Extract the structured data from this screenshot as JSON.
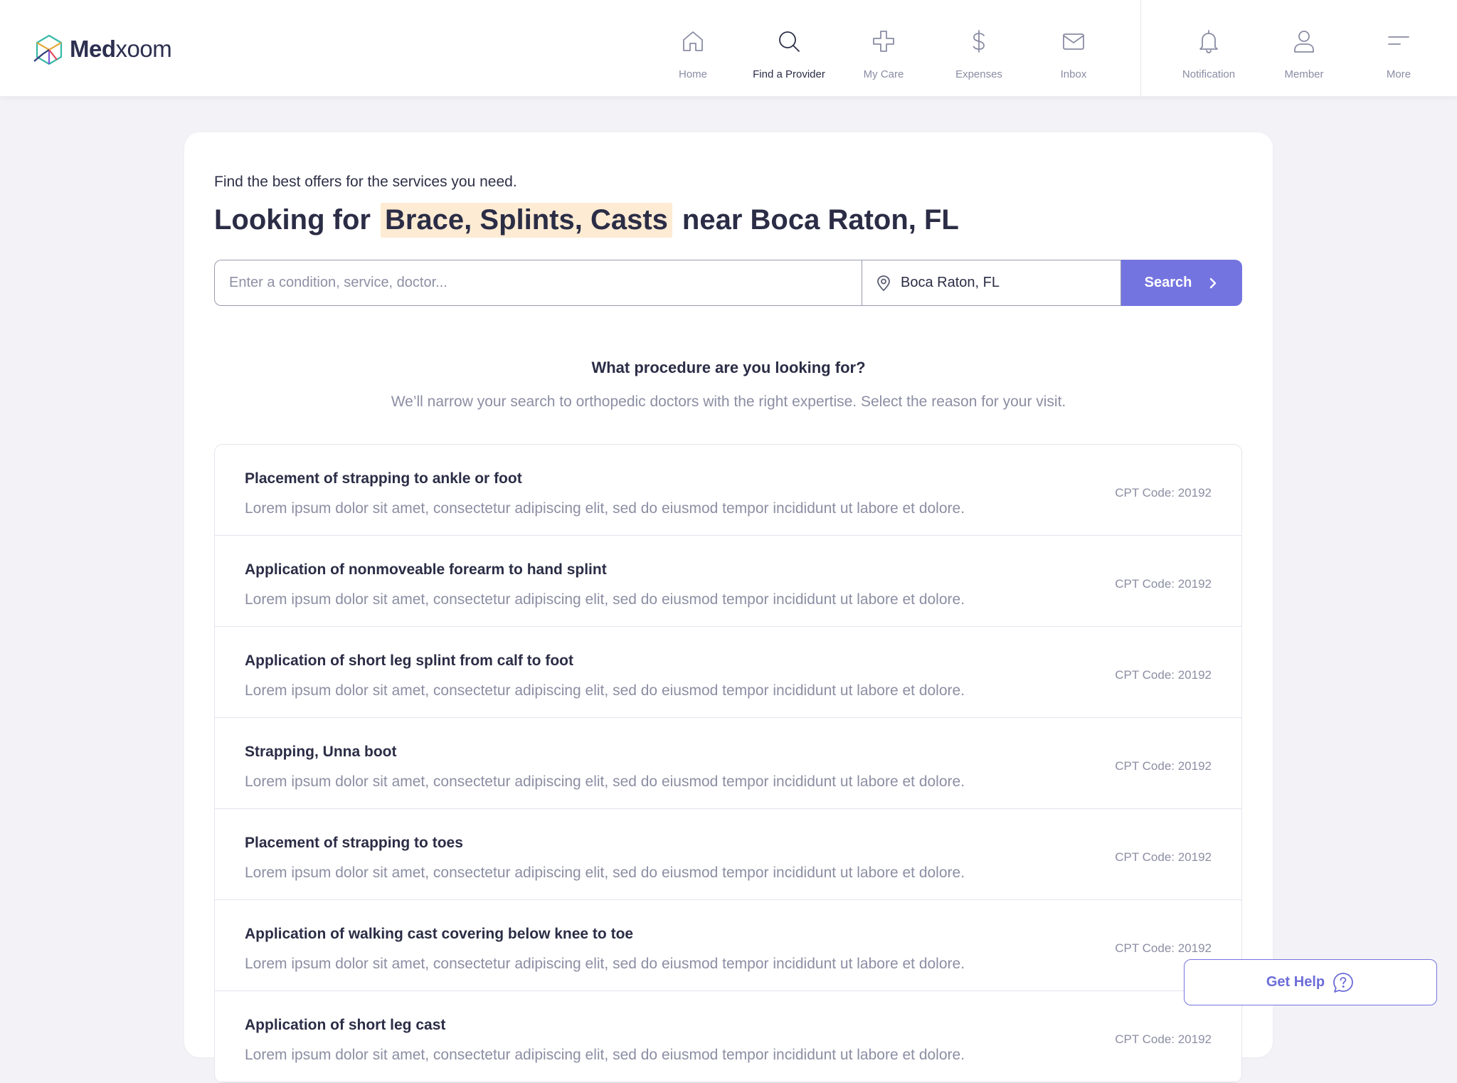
{
  "brand": {
    "name_bold": "Med",
    "name_light": "xoom"
  },
  "nav": {
    "items": [
      {
        "label": "Home",
        "icon": "home-icon",
        "active": false
      },
      {
        "label": "Find a Provider",
        "icon": "search-icon",
        "active": true
      },
      {
        "label": "My Care",
        "icon": "medical-cross-icon",
        "active": false
      },
      {
        "label": "Expenses",
        "icon": "dollar-icon",
        "active": false
      },
      {
        "label": "Inbox",
        "icon": "mail-icon",
        "active": false
      },
      {
        "label": "Notification",
        "icon": "bell-icon",
        "active": false
      },
      {
        "label": "Member",
        "icon": "user-icon",
        "active": false
      },
      {
        "label": "More",
        "icon": "menu-icon",
        "active": false
      }
    ]
  },
  "search": {
    "intro": "Find the best offers for the services you need.",
    "headline_prefix": "Looking for",
    "headline_highlight": "Brace, Splints, Casts",
    "headline_suffix": "near Boca Raton, FL",
    "query_placeholder": "Enter a condition, service, doctor...",
    "query_value": "",
    "location_value": "Boca Raton, FL",
    "button_label": "Search"
  },
  "procedures": {
    "title": "What procedure are you looking for?",
    "subtitle": "We’ll narrow your search to orthopedic doctors with the right expertise. Select the reason for your visit.",
    "items": [
      {
        "title": "Placement of strapping to ankle or foot",
        "description": "Lorem ipsum dolor sit amet, consectetur adipiscing elit, sed do eiusmod tempor incididunt ut labore et dolore.",
        "code": "CPT Code: 20192"
      },
      {
        "title": "Application of nonmoveable forearm to hand splint",
        "description": "Lorem ipsum dolor sit amet, consectetur adipiscing elit, sed do eiusmod tempor incididunt ut labore et dolore.",
        "code": "CPT Code: 20192"
      },
      {
        "title": "Application of short leg splint from calf to foot",
        "description": "Lorem ipsum dolor sit amet, consectetur adipiscing elit, sed do eiusmod tempor incididunt ut labore et dolore.",
        "code": "CPT Code: 20192"
      },
      {
        "title": "Strapping, Unna boot",
        "description": "Lorem ipsum dolor sit amet, consectetur adipiscing elit, sed do eiusmod tempor incididunt ut labore et dolore.",
        "code": "CPT Code: 20192"
      },
      {
        "title": "Placement of strapping to toes",
        "description": "Lorem ipsum dolor sit amet, consectetur adipiscing elit, sed do eiusmod tempor incididunt ut labore et dolore.",
        "code": "CPT Code: 20192"
      },
      {
        "title": "Application of walking cast covering below knee to toe",
        "description": "Lorem ipsum dolor sit amet, consectetur adipiscing elit, sed do eiusmod tempor incididunt ut labore et dolore.",
        "code": "CPT Code: 20192"
      },
      {
        "title": "Application of short leg cast",
        "description": "Lorem ipsum dolor sit amet, consectetur adipiscing elit, sed do eiusmod tempor incididunt ut labore et dolore.",
        "code": "CPT Code: 20192"
      }
    ]
  },
  "help": {
    "label": "Get Help",
    "icon": "help-chat-icon"
  },
  "colors": {
    "accent": "#7474e0",
    "highlight": "#fdebd3",
    "text_dark": "#2b2d46",
    "text_muted": "#8c8ea3",
    "background": "#f3f3f7"
  }
}
